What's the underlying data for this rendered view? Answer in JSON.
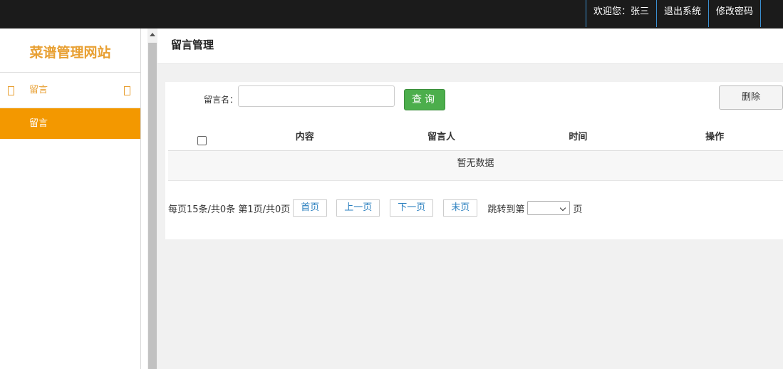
{
  "topbar": {
    "welcome": "欢迎您：张三",
    "logout": "退出系统",
    "change_password": "修改密码"
  },
  "sidebar": {
    "brand": "菜谱管理网站",
    "group_label": "留言",
    "item_label": "留言"
  },
  "page": {
    "title": "留言管理"
  },
  "search": {
    "label": "留言名：",
    "value": "",
    "query_button": "查询",
    "delete_button": "删除"
  },
  "table": {
    "columns": [
      "内容",
      "留言人",
      "时间",
      "操作"
    ],
    "empty_text": "暂无数据"
  },
  "pager": {
    "summary": "每页15条/共0条 第1页/共0页",
    "first": "首页",
    "prev": "上一页",
    "next": "下一页",
    "last": "末页",
    "jump_prefix": "跳转到第",
    "jump_suffix": "页"
  },
  "colors": {
    "accent": "#f39800",
    "brand_text": "#e8a033",
    "query_green": "#4cae4c",
    "topbar_bg": "#1b1b1b"
  }
}
